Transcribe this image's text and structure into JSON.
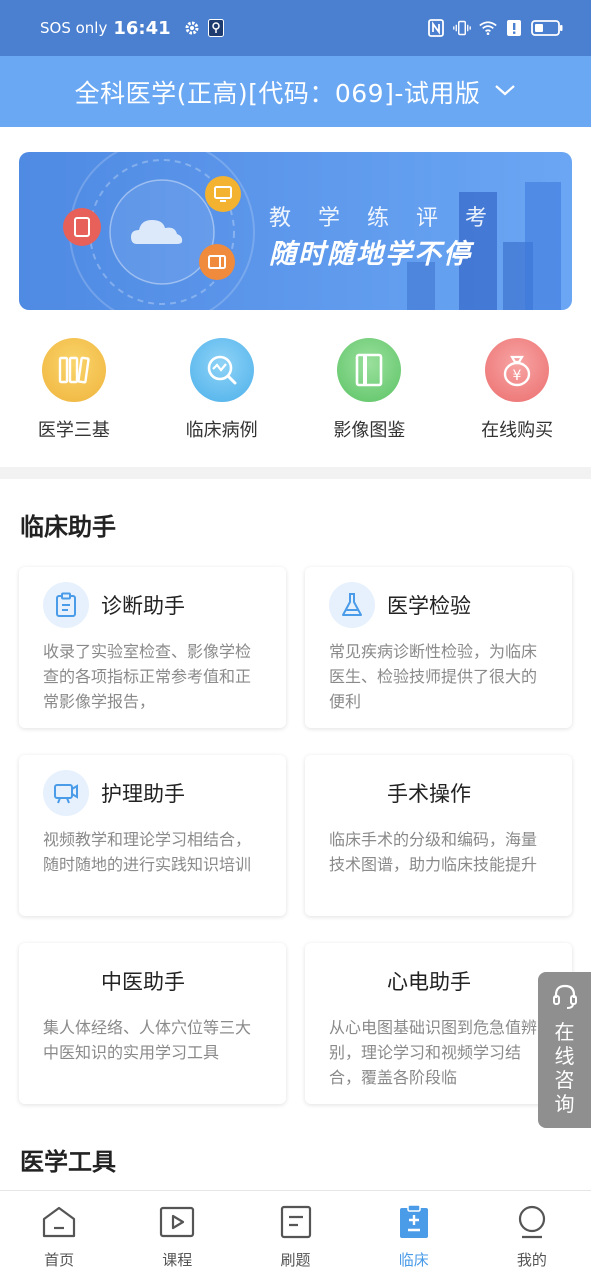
{
  "status_bar": {
    "carrier": "SOS only",
    "time": "16:41",
    "icons": [
      "settings-icon",
      "location-icon",
      "nfc-icon",
      "vibrate-icon",
      "wifi-icon",
      "alert-icon",
      "battery-icon"
    ]
  },
  "header": {
    "title": "全科医学(正高)[代码：069]-试用版",
    "dropdown_icon": "chevron-down-icon"
  },
  "banner": {
    "subtitle": "教 学 练 评 考",
    "headline": "随时随地学不停"
  },
  "quick_links": [
    {
      "label": "医学三基",
      "icon": "books-icon",
      "color": "#f2bc45"
    },
    {
      "label": "临床病例",
      "icon": "chart-search-icon",
      "color": "#5fb8ee"
    },
    {
      "label": "影像图鉴",
      "icon": "album-icon",
      "color": "#6ccc74"
    },
    {
      "label": "在线购买",
      "icon": "money-bag-icon",
      "color": "#f07a7a"
    }
  ],
  "clinical_section": {
    "title": "临床助手",
    "cards": [
      {
        "title": "诊断助手",
        "icon": "clipboard-icon",
        "desc": "收录了实验室检查、影像学检查的各项指标正常参考值和正常影像学报告，"
      },
      {
        "title": "医学检验",
        "icon": "flask-icon",
        "desc": "常见疾病诊断性检验，为临床医生、检验技师提供了很大的便利"
      },
      {
        "title": "护理助手",
        "icon": "video-icon",
        "desc": "视频教学和理论学习相结合，随时随地的进行实践知识培训"
      },
      {
        "title": "手术操作",
        "icon": "",
        "desc": "临床手术的分级和编码，海量技术图谱，助力临床技能提升"
      },
      {
        "title": "中医助手",
        "icon": "",
        "desc": "集人体经络、人体穴位等三大中医知识的实用学习工具"
      },
      {
        "title": "心电助手",
        "icon": "",
        "desc": "从心电图基础识图到危急值辨别，理论学习和视频学习结合，覆盖各阶段临"
      }
    ]
  },
  "tools_section": {
    "title": "医学工具"
  },
  "consult_button": {
    "label": "在线咨询",
    "icon": "headset-icon"
  },
  "bottom_nav": {
    "active_color": "#4a9be8",
    "items": [
      {
        "label": "首页",
        "icon": "home-icon"
      },
      {
        "label": "课程",
        "icon": "play-icon"
      },
      {
        "label": "刷题",
        "icon": "document-icon"
      },
      {
        "label": "临床",
        "icon": "clinical-clipboard-icon",
        "active": true
      },
      {
        "label": "我的",
        "icon": "user-icon"
      }
    ]
  }
}
